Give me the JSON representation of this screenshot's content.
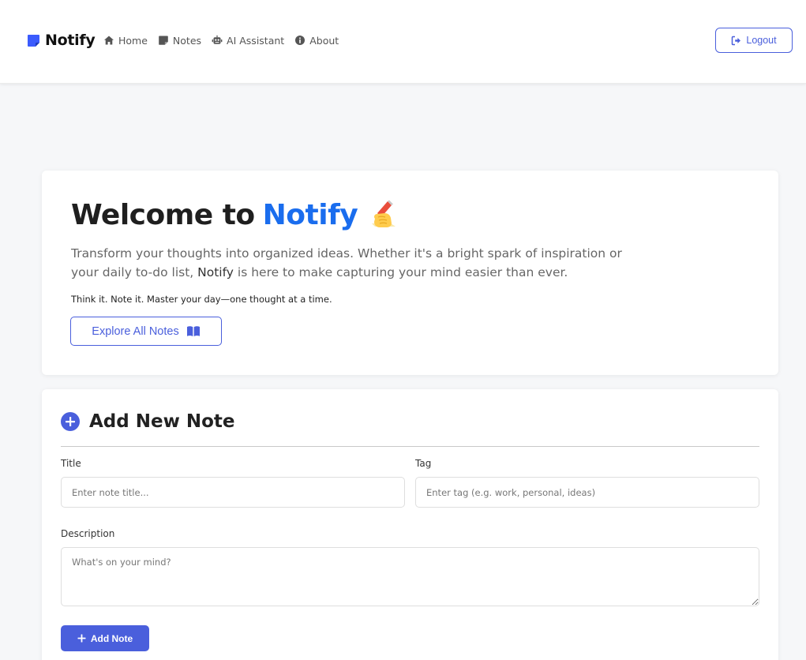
{
  "brand": {
    "name": "Notify",
    "color": "#3b5bfd"
  },
  "nav": {
    "items": [
      {
        "label": "Home",
        "icon": "home-icon"
      },
      {
        "label": "Notes",
        "icon": "sticky-note-icon"
      },
      {
        "label": "AI Assistant",
        "icon": "robot-icon"
      },
      {
        "label": "About",
        "icon": "info-circle-icon"
      }
    ],
    "logout_label": "Logout"
  },
  "hero": {
    "title_prefix": "Welcome to",
    "title_accent": "Notify",
    "emoji": "writing-hand-emoji",
    "desc_part1": "Transform your thoughts into organized ideas. Whether it's a bright spark of inspiration or your daily to-do list, ",
    "desc_brand": "Notify",
    "desc_part2": " is here to make capturing your mind easier than ever.",
    "tagline": "Think it. Note it. Master your day—one thought at a time.",
    "explore_label": "Explore All Notes"
  },
  "add_note": {
    "heading": "Add New Note",
    "title_label": "Title",
    "title_placeholder": "Enter note title...",
    "title_value": "",
    "tag_label": "Tag",
    "tag_placeholder": "Enter tag (e.g. work, personal, ideas)",
    "tag_value": "",
    "description_label": "Description",
    "description_placeholder": "What's on your mind?",
    "description_value": "",
    "submit_label": "Add Note"
  },
  "colors": {
    "accent": "#4a5fdc",
    "title_accent": "#1a6dee",
    "background": "#f6f7f9"
  }
}
